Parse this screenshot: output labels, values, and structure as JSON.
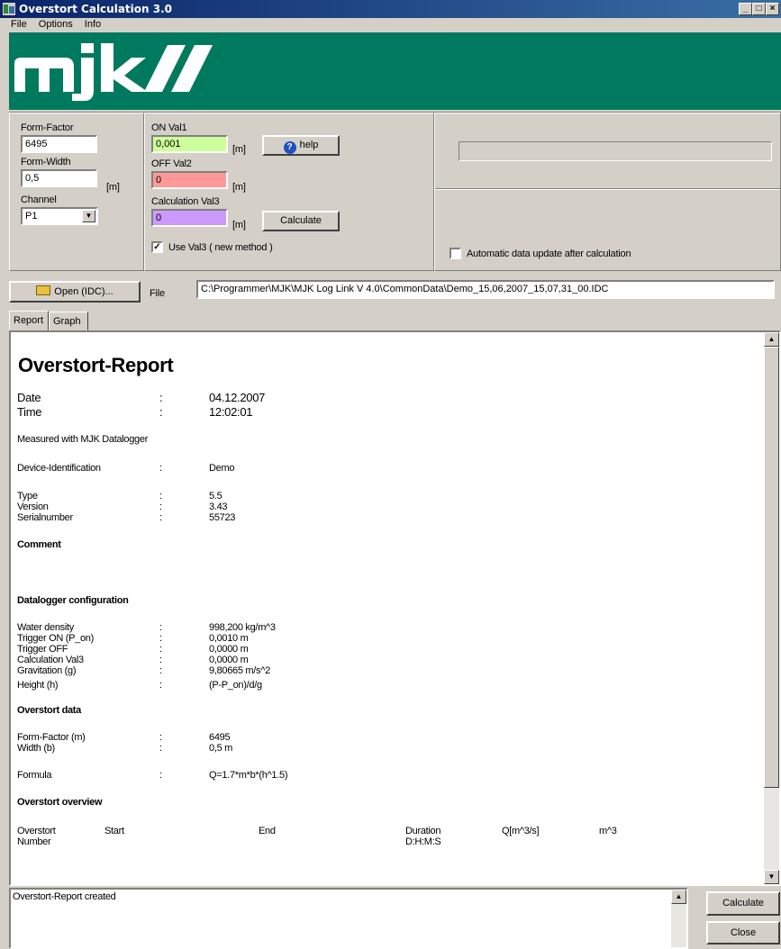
{
  "window": {
    "title": "Overstort Calculation 3.0",
    "controls": [
      "_",
      "□",
      "×"
    ]
  },
  "menu": [
    "File",
    "Options",
    "Info"
  ],
  "banner": {
    "logo_text": "mjk//",
    "bg_color": "#007a5e"
  },
  "form": {
    "form_factor_label": "Form-Factor",
    "form_factor_value": "6495",
    "form_width_label": "Form-Width",
    "form_width_value": "0,5",
    "form_width_unit": "[m]",
    "channel_label": "Channel",
    "channel_value": "P1",
    "on_label": "ON Val1",
    "on_value": "0,001",
    "on_unit": "[m]",
    "off_label": "OFF Val2",
    "off_value": "0",
    "off_unit": "[m]",
    "calc_label": "Calculation Val3",
    "calc_value": "0",
    "calc_unit": "[m]",
    "help_button": "help",
    "calculate_button": "Calculate",
    "use_val3_label": "Use Val3 ( new method )",
    "use_val3_checked": true,
    "auto_update_label": "Automatic data update after calculation",
    "auto_update_checked": false,
    "colors": {
      "on": "#ccff99",
      "off": "#ff9999",
      "calc": "#cc99ff"
    }
  },
  "file": {
    "open_button": "Open (IDC)...",
    "label": "File",
    "path": "C:\\Programmer\\MJK\\MJK Log Link V 4.0\\CommonData\\Demo_15,06,2007_15,07,31_00.IDC"
  },
  "tabs": [
    "Report",
    "Graph"
  ],
  "report": {
    "title": "Overstort-Report",
    "date_label": "Date",
    "date_value": "04.12.2007",
    "time_label": "Time",
    "time_value": "12:02:01",
    "measured": "Measured with MJK Datalogger",
    "device_label": "Device-Identification",
    "device_value": "Demo",
    "type_label": "Type",
    "type_value": "5.5",
    "version_label": "Version",
    "version_value": "3.43",
    "serial_label": "Serialnumber",
    "serial_value": "55723",
    "comment_heading": "Comment",
    "config_heading": "Datalogger configuration",
    "config_rows": [
      {
        "label": "Water density",
        "value": "998,200 kg/m^3"
      },
      {
        "label": "Trigger ON (P_on)",
        "value": "0,0010 m"
      },
      {
        "label": "Trigger OFF",
        "value": "0,0000 m"
      },
      {
        "label": "Calculation Val3",
        "value": "0,0000 m"
      },
      {
        "label": "Gravitation (g)",
        "value": "9,80665 m/s^2"
      }
    ],
    "height_label": "Height (h)",
    "height_value": "(P-P_on)/d/g",
    "data_heading": "Overstort data",
    "ff_label": "Form-Factor (m)",
    "ff_value": "6495",
    "width_label": "Width (b)",
    "width_value": "0,5 m",
    "formula_label": "Formula",
    "formula_value": "Q=1.7*m*b*(h^1.5)",
    "overview_heading": "Overstort overview",
    "col_overstort": "Overstort",
    "col_number": "Number",
    "col_start": "Start",
    "col_end": "End",
    "col_duration": "Duration",
    "col_dhms": "D:H:M:S",
    "col_q": "Q[m^3/s]",
    "col_m3": "m^3",
    "colon": ":"
  },
  "status": {
    "message": "Overstort-Report created"
  },
  "bottom_buttons": {
    "calculate": "Calculate",
    "close": "Close"
  }
}
